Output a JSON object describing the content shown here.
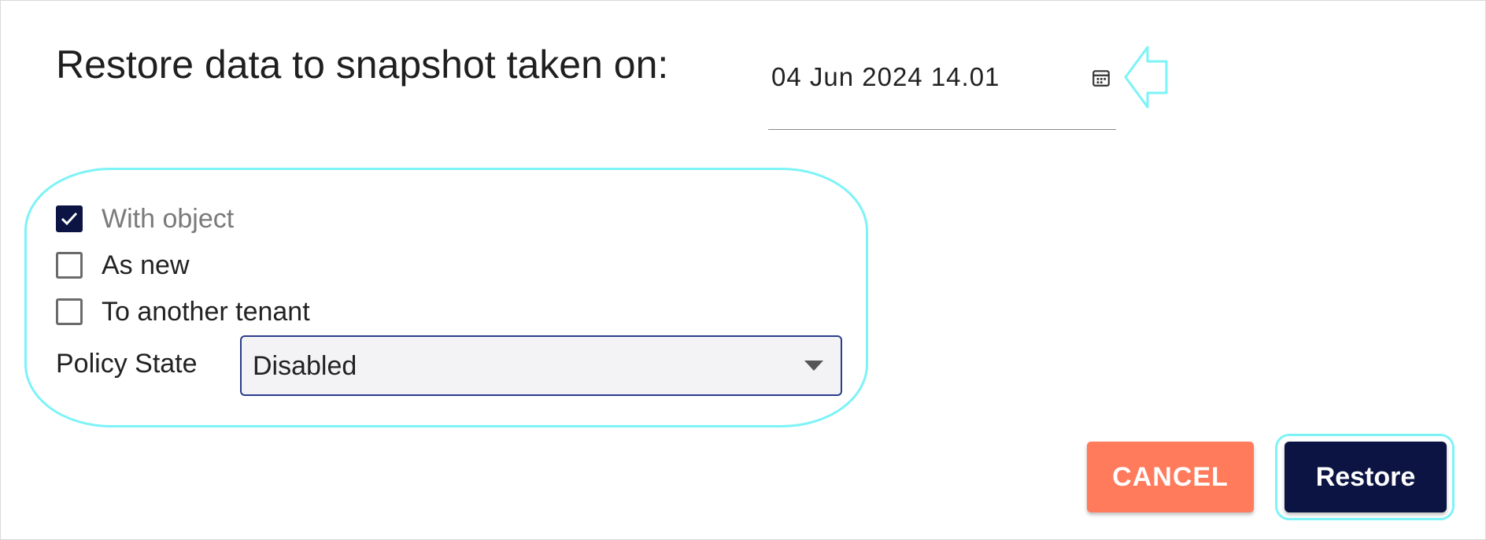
{
  "dialog": {
    "title": "Restore data to snapshot taken on:",
    "snapshot_date": "04 Jun 2024 14.01",
    "calendar_icon": "calendar-icon"
  },
  "options": {
    "checkboxes": [
      {
        "label": "With object",
        "checked": true
      },
      {
        "label": "As new",
        "checked": false
      },
      {
        "label": "To another tenant",
        "checked": false
      }
    ],
    "policy_state": {
      "label": "Policy State",
      "value": "Disabled"
    }
  },
  "actions": {
    "cancel_label": "CANCEL",
    "restore_label": "Restore"
  },
  "colors": {
    "primary": "#0b1442",
    "cancel": "#ff7b5c",
    "annotation": "#7df3f7"
  }
}
